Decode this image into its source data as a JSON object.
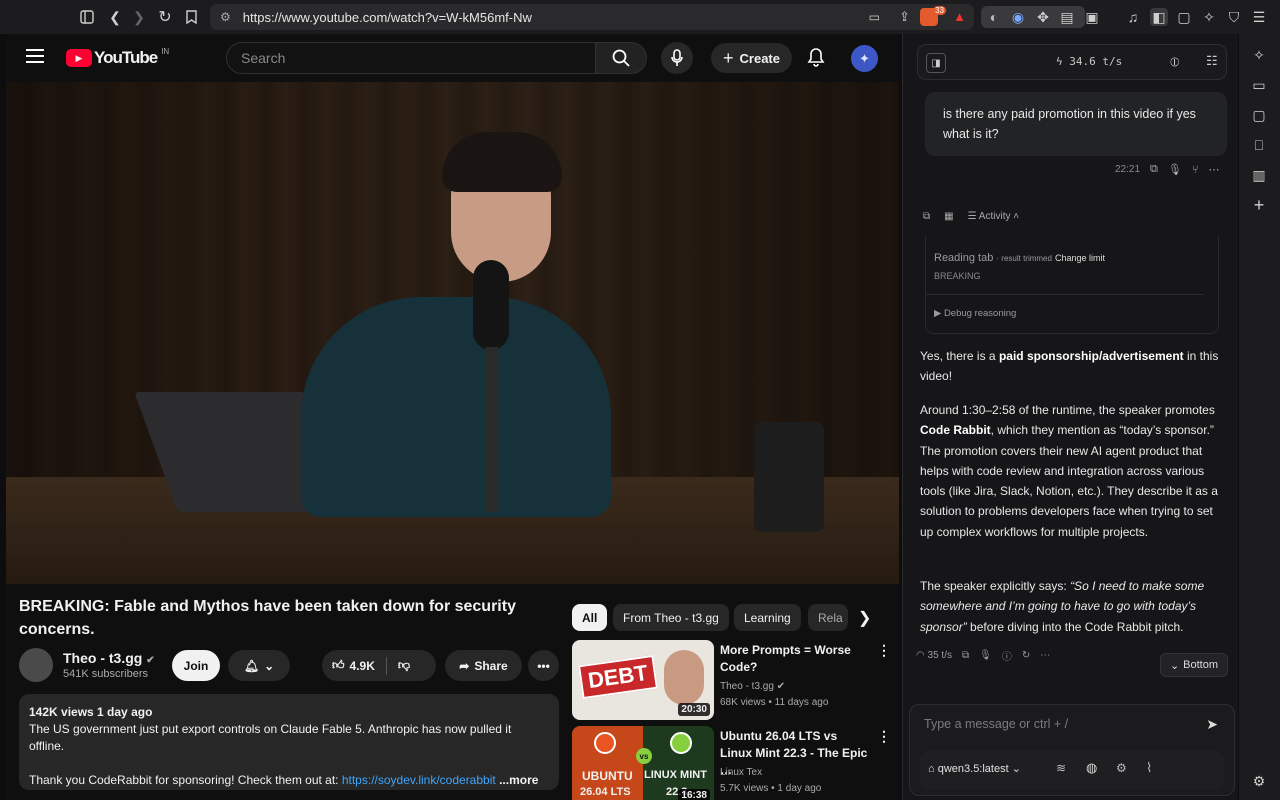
{
  "browser": {
    "url": "https://www.youtube.com/watch?v=W-kM56mf-Nw",
    "brave_badge": "33",
    "icons": [
      "sidebar-icon",
      "back-icon",
      "forward-icon",
      "reload-icon",
      "bookmark-icon",
      "site-settings-icon",
      "cast-icon",
      "share-icon",
      "brave-shield-icon",
      "brave-rewards-icon",
      "extensions-icon",
      "reader-icon",
      "media-icon",
      "sidebar-toggle-icon",
      "wallet-icon",
      "leo-icon",
      "vpn-icon",
      "menu-icon"
    ]
  },
  "youtube": {
    "logo_text": "YouTube",
    "country": "IN",
    "search_placeholder": "Search",
    "create_label": "Create",
    "title": "BREAKING: Fable and Mythos have been taken down for security concerns.",
    "channel": "Theo - t3.gg",
    "subscribers": "541K subscribers",
    "join_label": "Join",
    "likes": "4.9K",
    "share_label": "Share",
    "desc_meta": "142K views  1 day ago",
    "desc_line1": "The US government just put export controls on Claude Fable 5. Anthropic has now pulled it offline.",
    "desc_line2": "Thank you CodeRabbit for sponsoring! Check them out at: ",
    "desc_link": "https://soydev.link/coderabbit",
    "desc_more": "...more",
    "chips": [
      "All",
      "From Theo - t3.gg",
      "Learning",
      "Rela"
    ],
    "recommendations": [
      {
        "title": "More Prompts = Worse Code?",
        "channel": "Theo - t3.gg",
        "meta": "68K views • 11 days ago",
        "duration": "20:30",
        "thumb_text": "DEBT"
      },
      {
        "title": "Ubuntu 26.04 LTS vs Linux Mint 22.3 - The Epic …",
        "channel": "Linux Tex",
        "meta": "5.7K views • 1 day ago",
        "duration": "16:38",
        "thumb_left": "UBUNTU",
        "thumb_left2": "26.04 LTS",
        "thumb_right": "LINUX MINT",
        "thumb_right2": "22.3",
        "vs": "vs"
      }
    ]
  },
  "assistant": {
    "speed": "34.6 t/s",
    "user_message": "is there any paid promotion in this video if yes what is it?",
    "msg_time": "22:21",
    "activity_label": "Activity",
    "reading_tab": "Reading tab",
    "trimmed": "· result trimmed",
    "change_limit": "Change limit",
    "reading_title": "BREAKING",
    "debug": "▶ Debug reasoning",
    "p1_a": "Yes, there is a ",
    "p1_b": "paid sponsorship/advertisement",
    "p1_c": " in this video!",
    "p2_a": "Around 1:30–2:58 of the runtime, the speaker promotes ",
    "p2_b": "Code Rabbit",
    "p2_c": ", which they mention as “today’s sponsor.” The promotion covers their new AI agent product that helps with code review and integration across various tools (like Jira, Slack, Notion, etc.). They describe it as a solution to problems developers face when trying to set up complex workflows for multiple projects.",
    "p3_a": "The speaker explicitly says: ",
    "p3_b": "“So I need to make some somewhere and I’m going to have to go with today’s sponsor”",
    "p3_c": " before diving into the Code Rabbit pitch.",
    "resp_speed": "35 t/s",
    "bottom_label": "Bottom",
    "input_placeholder": "Type a message or ctrl + /",
    "model": "qwen3.5:latest"
  }
}
